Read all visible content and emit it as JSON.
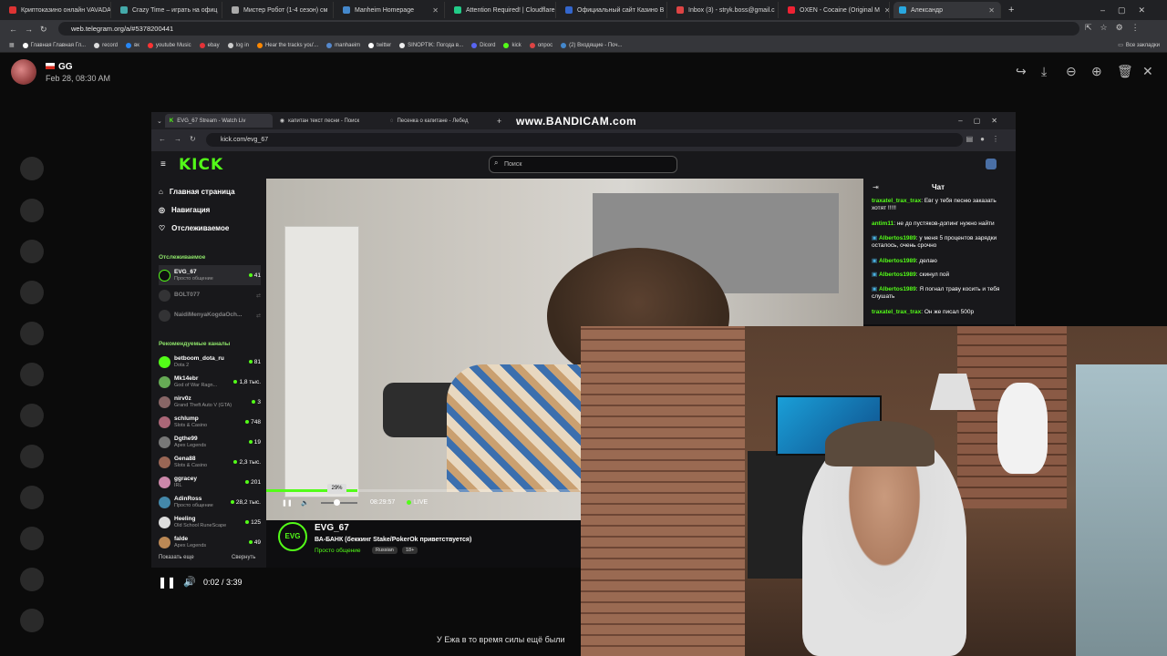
{
  "outer_browser": {
    "tabs": [
      {
        "label": "Криптоказино онлайн VAVADA",
        "color": "#d33"
      },
      {
        "label": "Crazy Time – играть на офиц",
        "color": "#4aa"
      },
      {
        "label": "Мистер Робот (1-4 сезон) см",
        "color": "#aaa"
      },
      {
        "label": "Manheim Homepage",
        "color": "#48c"
      },
      {
        "label": "Attention Required! | Cloudflare",
        "color": "#2c8"
      },
      {
        "label": "Официальный сайт Казино В",
        "color": "#36c"
      },
      {
        "label": "Inbox (3) - stryk.boss@gmail.c",
        "color": "#d44"
      },
      {
        "label": "OXEN - Cocaine (Original M",
        "color": "#e23"
      },
      {
        "label": "Александр",
        "color": "#29a8e0"
      }
    ],
    "url": "web.telegram.org/a/#5378200441",
    "bookmarks": [
      "Главная Главная Гл...",
      "record",
      "вк",
      "youtube Music",
      "ebay",
      "log in",
      "Hear the tracks you'...",
      "manhaeim",
      "twitter",
      "SINOPTIK: Погода в...",
      "Dicord",
      "kick",
      "опрос",
      "(2) Входящие - Поч..."
    ],
    "all_bookmarks": "Все закладки"
  },
  "telegram": {
    "sender": "GG",
    "date": "Feb 28, 08:30 AM",
    "player_time": "0:02 / 3:39",
    "caption": "У Ежа в то время силы ещё были"
  },
  "inner_browser": {
    "tabs": [
      "EVG_67 Stream - Watch Liv",
      "капитан текст песни - Поиск",
      "Песенка о капитане - Лебед"
    ],
    "watermark": "www.BANDICAM.com",
    "url": "kick.com/evg_67"
  },
  "kick": {
    "logo": "KICK",
    "search_placeholder": "Поиск",
    "nav": [
      "Главная страница",
      "Навигация",
      "Отслеживаемое"
    ],
    "followed_header": "Отслеживаемое",
    "followed": [
      {
        "name": "EVG_67",
        "game": "Просто общение",
        "count": "41"
      },
      {
        "name": "BOLT077",
        "game": "",
        "count": ""
      },
      {
        "name": "NaidiMenyaKogdaOch...",
        "game": "",
        "count": ""
      }
    ],
    "recommended_header": "Рекомендуемые каналы",
    "recommended": [
      {
        "name": "betboom_dota_ru",
        "game": "Dota 2",
        "count": "81"
      },
      {
        "name": "Mk14ebr",
        "game": "God of War Ragn...",
        "count": "1,8 тыс."
      },
      {
        "name": "nirv0z",
        "game": "Grand Theft Auto V (GTA)",
        "count": "3"
      },
      {
        "name": "schlump",
        "game": "Slots & Casino",
        "count": "748"
      },
      {
        "name": "Dgthe99",
        "game": "Apex Legends",
        "count": "19"
      },
      {
        "name": "Gena88",
        "game": "Slots & Casino",
        "count": "2,3 тыс."
      },
      {
        "name": "ggracey",
        "game": "IRL",
        "count": "201"
      },
      {
        "name": "AdinRoss",
        "game": "Просто общение",
        "count": "28,2 тыс."
      },
      {
        "name": "Heeling",
        "game": "Old School RuneScape",
        "count": "125"
      },
      {
        "name": "falde",
        "game": "Apex Legends",
        "count": "49"
      }
    ],
    "show_more": "Показать еще",
    "collapse": "Свернуть",
    "player": {
      "tooltip": "29%",
      "progress": 0.29,
      "time": "08:29:57",
      "live": "LIVE"
    },
    "stream": {
      "channel": "EVG_67",
      "title": "ВА-БАНК  (беккинг Stake/PokerOk приветствуется)",
      "category": "Просто общение",
      "tags": [
        "Russian",
        "18+"
      ]
    },
    "chat_title": "Чат",
    "chat": [
      {
        "user": "traxatel_trax_trax",
        "color": "#53fc18",
        "text": ": Евг у тебя песню заказать хотят !!!!!"
      },
      {
        "user": "antim11",
        "color": "#53fc18",
        "text": ": не до пустяков-допинг нужно найти"
      },
      {
        "user": "Albertos1989",
        "color": "#53fc18",
        "text": ": у меня 5 процентов зарядки осталось, очень срочно"
      },
      {
        "user": "Albertos1989",
        "color": "#53fc18",
        "text": ": делаю"
      },
      {
        "user": "Albertos1989",
        "color": "#53fc18",
        "text": ": скинул пой"
      },
      {
        "user": "Albertos1989",
        "color": "#53fc18",
        "text": ": Я погнал траву косить и тебя слушать"
      },
      {
        "user": "traxatel_trax_trax",
        "color": "#53fc18",
        "text": ": Он же писал 500р"
      }
    ]
  },
  "colors": {
    "kick_green": "#53fc18",
    "bg": "#0b0b0b"
  }
}
